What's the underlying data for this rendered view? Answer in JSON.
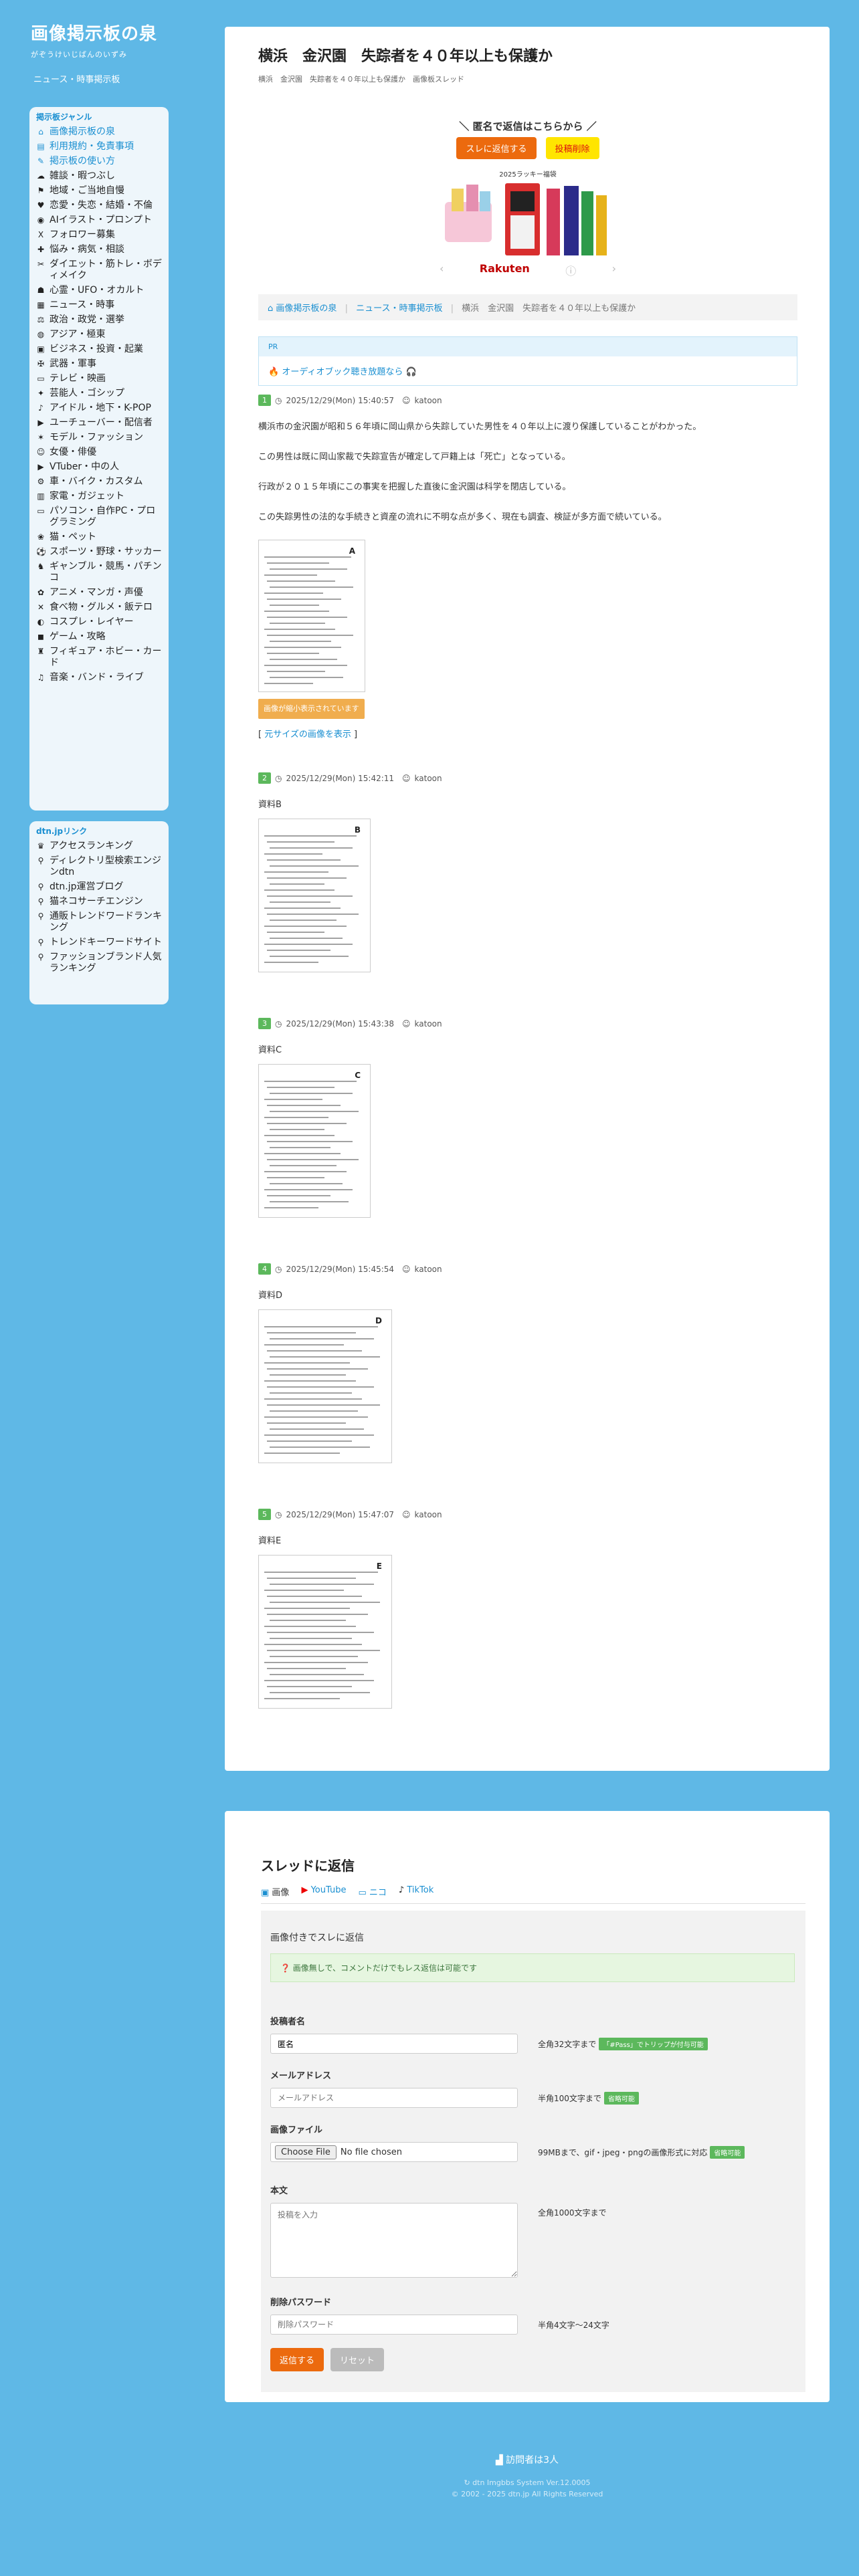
{
  "site": {
    "title": "画像掲示板の泉",
    "subtitle": "がぞうけいじばんのいずみ",
    "category_link": "ニュース・時事掲示板"
  },
  "genres": {
    "title": "掲示板ジャンル",
    "items": [
      {
        "icon": "⌂",
        "label": "画像掲示板の泉",
        "blue": true
      },
      {
        "icon": "▤",
        "label": "利用規約・免責事項",
        "blue": true
      },
      {
        "icon": "✎",
        "label": "掲示板の使い方",
        "blue": true
      },
      {
        "icon": "☁",
        "label": "雑談・暇つぶし"
      },
      {
        "icon": "⚑",
        "label": "地域・ご当地自慢"
      },
      {
        "icon": "♥",
        "label": "恋愛・失恋・結婚・不倫"
      },
      {
        "icon": "◉",
        "label": "AIイラスト・プロンプト"
      },
      {
        "icon": "X",
        "label": "フォロワー募集"
      },
      {
        "icon": "✚",
        "label": "悩み・病気・相談"
      },
      {
        "icon": "✂",
        "label": "ダイエット・筋トレ・ボディメイク"
      },
      {
        "icon": "☗",
        "label": "心霊・UFO・オカルト"
      },
      {
        "icon": "▦",
        "label": "ニュース・時事"
      },
      {
        "icon": "⚖",
        "label": "政治・政党・選挙"
      },
      {
        "icon": "◍",
        "label": "アジア・極東"
      },
      {
        "icon": "▣",
        "label": "ビジネス・投資・起業"
      },
      {
        "icon": "✠",
        "label": "武器・軍事"
      },
      {
        "icon": "▭",
        "label": "テレビ・映画"
      },
      {
        "icon": "✦",
        "label": "芸能人・ゴシップ"
      },
      {
        "icon": "♪",
        "label": "アイドル・地下・K-POP"
      },
      {
        "icon": "▶",
        "label": "ユーチューバー・配信者"
      },
      {
        "icon": "✶",
        "label": "モデル・ファッション"
      },
      {
        "icon": "☺",
        "label": "女優・俳優"
      },
      {
        "icon": "▶",
        "label": "VTuber・中の人"
      },
      {
        "icon": "⚙",
        "label": "車・バイク・カスタム"
      },
      {
        "icon": "▥",
        "label": "家電・ガジェット"
      },
      {
        "icon": "▭",
        "label": "パソコン・自作PC・プログラミング"
      },
      {
        "icon": "❀",
        "label": "猫・ペット"
      },
      {
        "icon": "⚽",
        "label": "スポーツ・野球・サッカー"
      },
      {
        "icon": "♞",
        "label": "ギャンブル・競馬・パチンコ"
      },
      {
        "icon": "✿",
        "label": "アニメ・マンガ・声優"
      },
      {
        "icon": "✕",
        "label": "食べ物・グルメ・飯テロ"
      },
      {
        "icon": "◐",
        "label": "コスプレ・レイヤー"
      },
      {
        "icon": "◼",
        "label": "ゲーム・攻略"
      },
      {
        "icon": "♜",
        "label": "フィギュア・ホビー・カード"
      },
      {
        "icon": "♫",
        "label": "音楽・バンド・ライブ"
      }
    ]
  },
  "links": {
    "title": "dtn.jpリンク",
    "items": [
      {
        "icon": "♛",
        "label": "アクセスランキング"
      },
      {
        "icon": "⚲",
        "label": "ディレクトリ型検索エンジンdtn"
      },
      {
        "icon": "⚲",
        "label": "dtn.jp運営ブログ"
      },
      {
        "icon": "⚲",
        "label": "猫ネコサーチエンジン"
      },
      {
        "icon": "⚲",
        "label": "通販トレンドワードランキング"
      },
      {
        "icon": "⚲",
        "label": "トレンドキーワードサイト"
      },
      {
        "icon": "⚲",
        "label": "ファッションブランド人気ランキング"
      }
    ]
  },
  "thread": {
    "title": "横浜　金沢園　失踪者を４０年以上も保護か",
    "crumbs": "横浜　金沢園　失踪者を４０年以上も保護か　画像板スレッド",
    "promo_head": "＼ 匿名で返信はこちらから ／",
    "reply_button": "スレに返信する",
    "delete_button": "投稿削除",
    "ad_badge": "2025ラッキー福袋",
    "ad_logo": "Rakuten",
    "breadcrumb": [
      "画像掲示板の泉",
      "ニュース・時事掲示板",
      "横浜　金沢園　失踪者を４０年以上も保護か"
    ],
    "pr_label": "PR",
    "pr_text": "オーディオブック聴き放題なら"
  },
  "posts": [
    {
      "no": "1",
      "date": "2025/12/29(Mon) 15:40:57",
      "user": "katoon",
      "paragraphs": [
        "横浜市の金沢園が昭和５６年頃に岡山県から失踪していた男性を４０年以上に渡り保護していることがわかった。",
        "この男性は既に岡山家裁で失踪宣告が確定して戸籍上は「死亡」となっている。",
        "行政が２０１５年頃にこの事実を把握した直後に金沢園は科学を閉店している。",
        "この失踪男性の法的な手続きと資産の流れに不明な点が多く、現在も調査、検証が多方面で続いている。"
      ],
      "img_label": "A",
      "warn": "画像が縮小表示されています",
      "fullsize": "元サイズの画像を表示"
    },
    {
      "no": "2",
      "date": "2025/12/29(Mon) 15:42:11",
      "user": "katoon",
      "text": "資料B",
      "img_label": "B"
    },
    {
      "no": "3",
      "date": "2025/12/29(Mon) 15:43:38",
      "user": "katoon",
      "text": "資料C",
      "img_label": "C"
    },
    {
      "no": "4",
      "date": "2025/12/29(Mon) 15:45:54",
      "user": "katoon",
      "text": "資料D",
      "img_label": "D"
    },
    {
      "no": "5",
      "date": "2025/12/29(Mon) 15:47:07",
      "user": "katoon",
      "text": "資料E",
      "img_label": "E"
    }
  ],
  "reply": {
    "title": "スレッドに返信",
    "tabs": [
      "画像",
      "YouTube",
      "ニコ",
      "TikTok"
    ],
    "form_sub": "画像付きでスレに返信",
    "info": "画像無しで、コメントだけでもレス返信は可能です",
    "name_label": "投稿者名",
    "name_value": "匿名",
    "name_hint": "全角32文字まで",
    "name_tag": "「#Pass」でトリップが付与可能",
    "mail_label": "メールアドレス",
    "mail_placeholder": "メールアドレス",
    "mail_hint": "半角100文字まで",
    "mail_tag": "省略可能",
    "file_label": "画像ファイル",
    "file_button": "Choose File",
    "file_status": "No file chosen",
    "file_hint": "99MBまで、gif・jpeg・pngの画像形式に対応",
    "file_tag": "省略可能",
    "body_label": "本文",
    "body_placeholder": "投稿を入力",
    "body_hint": "全角1000文字まで",
    "pass_label": "削除パスワード",
    "pass_placeholder": "削除パスワード",
    "pass_hint": "半角4文字〜24文字",
    "submit": "返信する",
    "reset": "リセット"
  },
  "footer": {
    "visitors": "訪問者は3人",
    "system": "dtn Imgbbs System Ver.12.0005",
    "copyright": "2002 - 2025 dtn.jp All Rights Reserved"
  },
  "colors": {
    "background": "#5fb8e6",
    "accent_blue": "#1a8fd1",
    "orange": "#ec6a0e",
    "yellow": "#ffe500",
    "green": "#5cb85c"
  }
}
